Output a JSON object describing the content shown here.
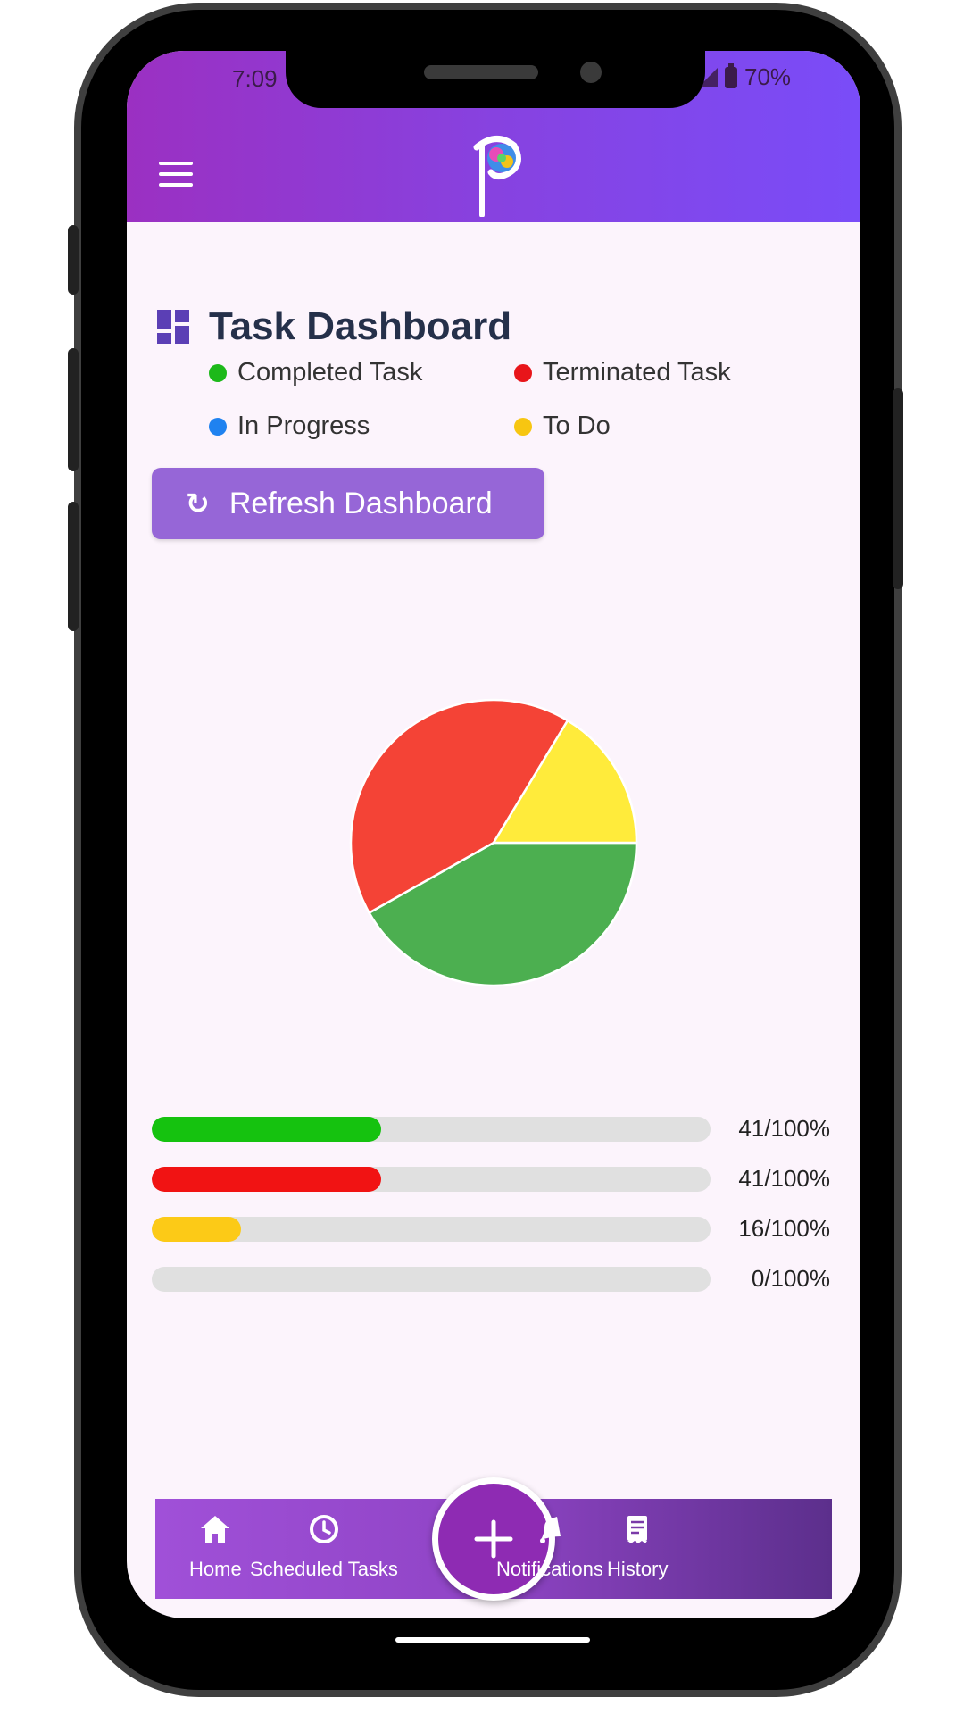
{
  "status_bar": {
    "time": "7:09",
    "battery": "70%"
  },
  "header": {
    "menu_icon": "hamburger-menu-icon",
    "logo": "app-logo"
  },
  "dashboard": {
    "title": "Task Dashboard",
    "title_icon": "dashboard-grid-icon",
    "legend": [
      {
        "label": "Completed Task",
        "color": "#1db91a"
      },
      {
        "label": "Terminated Task",
        "color": "#e8151a"
      },
      {
        "label": "In Progress",
        "color": "#1f82f0"
      },
      {
        "label": "To Do",
        "color": "#f7c611"
      }
    ],
    "refresh_button": {
      "label": "Refresh Dashboard",
      "icon": "refresh-icon"
    }
  },
  "chart_data": {
    "type": "pie",
    "slices": [
      {
        "label": "Completed Task",
        "value": 41,
        "color": "#4caf50"
      },
      {
        "label": "Terminated Task",
        "value": 41,
        "color": "#f44336"
      },
      {
        "label": "To Do",
        "value": 16,
        "color": "#ffeb3b"
      },
      {
        "label": "In Progress",
        "value": 0,
        "color": "#1f82f0"
      }
    ]
  },
  "progress_bars": [
    {
      "value": 41,
      "color": "#15c20f",
      "label": "41/100%"
    },
    {
      "value": 41,
      "color": "#f11313",
      "label": "41/100%"
    },
    {
      "value": 16,
      "color": "#fcca17",
      "label": "16/100%"
    },
    {
      "value": 0,
      "color": "#1f82f0",
      "label": "0/100%"
    }
  ],
  "bottom_nav": {
    "items": [
      {
        "label": "Home",
        "icon": "home-icon"
      },
      {
        "label": "Scheduled Tasks",
        "icon": "clock-icon"
      },
      {
        "label": "Notifications",
        "icon": "bell-icon"
      },
      {
        "label": "History",
        "icon": "receipt-icon"
      }
    ],
    "fab_icon": "plus-icon"
  }
}
